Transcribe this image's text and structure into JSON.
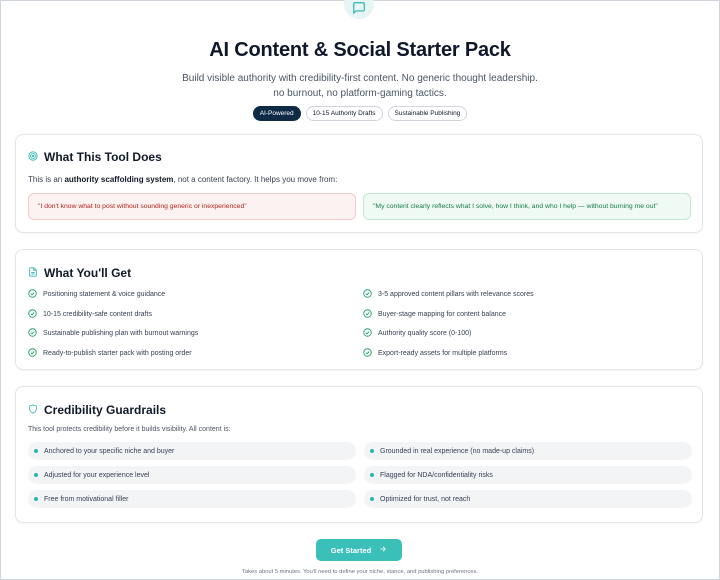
{
  "hero": {
    "title": "AI Content & Social Starter Pack",
    "subtitle_line1": "Build visible authority with credibility-first content. No generic thought leadership.",
    "subtitle_line2": "no burnout, no platform-gaming tactics.",
    "badges": [
      "AI-Powered",
      "10-15 Authority Drafts",
      "Sustainable Publishing"
    ],
    "icon": "chat-bubble-icon"
  },
  "what_it_does": {
    "title": "What This Tool Does",
    "icon": "target-icon",
    "intro_prefix": "This is an",
    "intro_bold": "authority scaffolding system",
    "intro_suffix": ", not a content factory. It helps you move from:",
    "from_quote": "\"I don't know what to post without sounding generic or inexperienced\"",
    "to_quote": "\"My content clearly reflects what I solve, how I think, and who I help — without burning me out\""
  },
  "what_you_get": {
    "title": "What You'll Get",
    "icon": "document-icon",
    "items": [
      "Positioning statement & voice guidance",
      "3-5 approved content pillars with relevance scores",
      "10-15 credibility-safe content drafts",
      "Buyer-stage mapping for content balance",
      "Sustainable publishing plan with burnout warnings",
      "Authority quality score (0-100)",
      "Ready-to-publish starter pack with posting order",
      "Export-ready assets for multiple platforms"
    ]
  },
  "guardrails": {
    "title": "Credibility Guardrails",
    "icon": "shield-icon",
    "intro": "This tool protects credibility before it builds visibility. All content is:",
    "items": [
      "Anchored to your specific niche and buyer",
      "Grounded in real experience (no made-up claims)",
      "Adjusted for your experience level",
      "Flagged for NDA/confidentiality risks",
      "Free from motivational filler",
      "Optimized for trust, not reach"
    ]
  },
  "cta": {
    "label": "Get Started",
    "footnote": "Takes about 5 minutes. You'll need to define your niche, stance, and publishing preferences."
  },
  "colors": {
    "accent": "#3bbfb9",
    "dark_badge": "#0f2a44",
    "from_bg": "#fdf2f2",
    "to_bg": "#effaf4"
  }
}
